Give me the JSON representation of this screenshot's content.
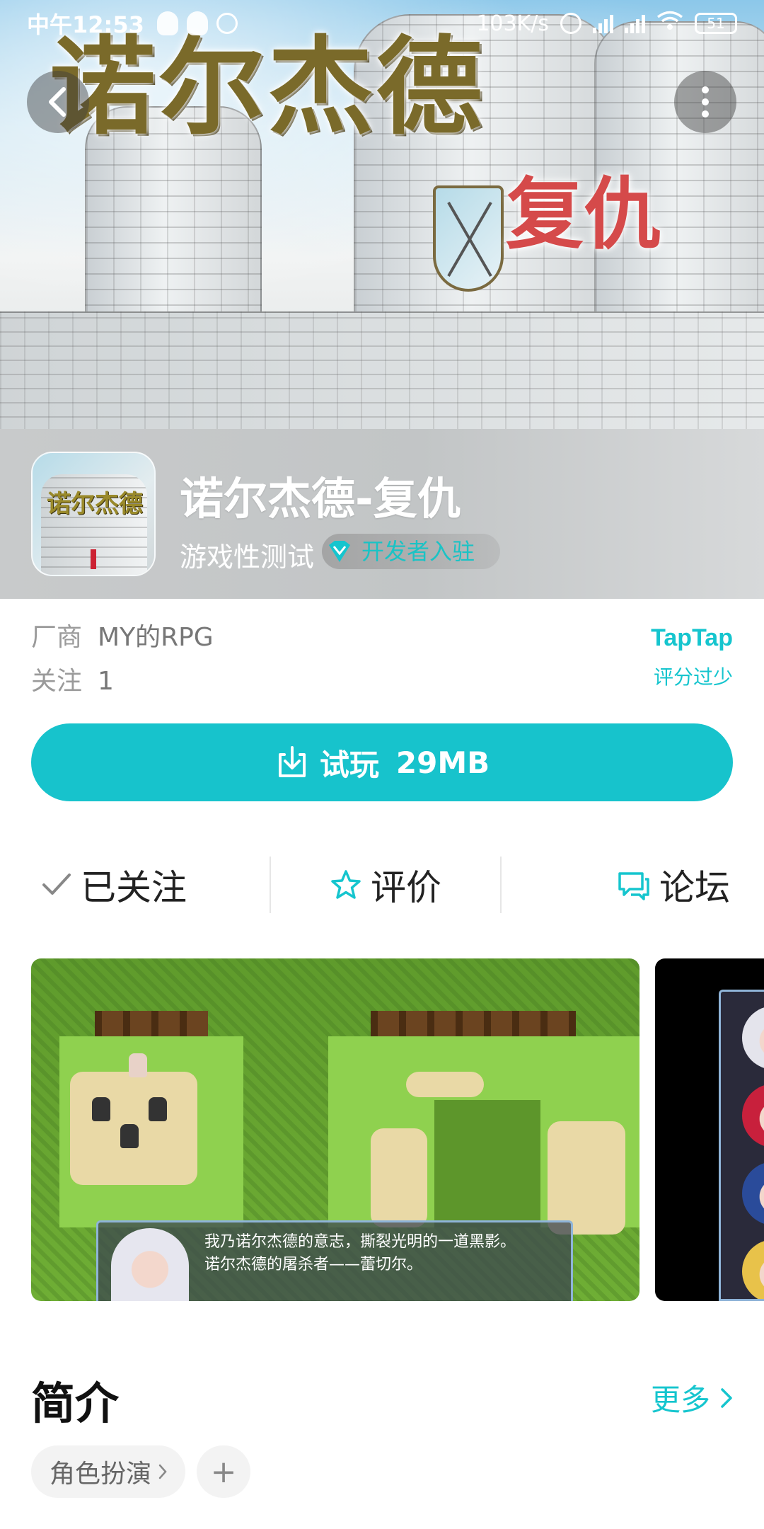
{
  "status_bar": {
    "time": "中午12:53",
    "network_speed": "103K/s",
    "battery": "51"
  },
  "banner": {
    "title": "诺尔杰德",
    "subtitle": "复仇"
  },
  "app": {
    "icon_text": "诺尔杰德",
    "name": "诺尔杰德-复仇",
    "status": "游戏性测试",
    "dev_badge": "开发者入驻"
  },
  "meta": {
    "vendor_label": "厂商",
    "vendor_value": "MY的RPG",
    "follow_label": "关注",
    "follow_value": "1"
  },
  "rating": {
    "logo": "TapTap",
    "note": "评分过少"
  },
  "download": {
    "label": "试玩",
    "size": "29MB"
  },
  "actions": {
    "followed": "已关注",
    "review": "评价",
    "forum": "论坛"
  },
  "screenshot": {
    "dialog_line1": "我乃诺尔杰德的意志，撕裂光明的一道黑影。",
    "dialog_line2": "诺尔杰德的屠杀者——蕾切尔。"
  },
  "intro": {
    "title": "简介",
    "more": "更多",
    "tags": [
      "角色扮演"
    ],
    "add_tag": "+"
  },
  "colors": {
    "accent": "#17c3cc",
    "title_gold": "#7a6a2a",
    "subtitle_red": "#d54a4a"
  },
  "icons": [
    "back-arrow-icon",
    "more-vertical-icon",
    "download-icon",
    "check-icon",
    "star-outline-icon",
    "chat-bubble-icon",
    "chevron-right-icon",
    "diamond-badge-icon"
  ]
}
